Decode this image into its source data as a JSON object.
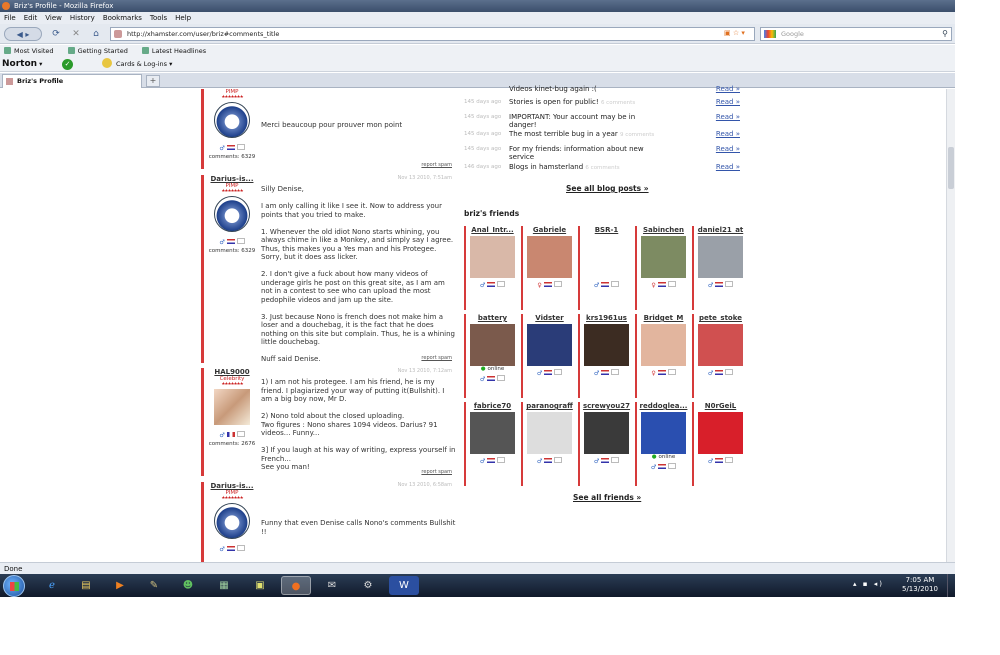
{
  "window": {
    "title": "Briz's Profile - Mozilla Firefox"
  },
  "menu": [
    "File",
    "Edit",
    "View",
    "History",
    "Bookmarks",
    "Tools",
    "Help"
  ],
  "url": "http://xhamster.com/user/briz#comments_title",
  "search_placeholder": "Google",
  "bookmarks": [
    "Most Visited",
    "Getting Started",
    "Latest Headlines"
  ],
  "norton": {
    "brand": "Norton",
    "cards_label": "Cards & Log-ins"
  },
  "tab": {
    "title": "Briz's Profile",
    "new_tab": "+"
  },
  "status": "Done",
  "comments": [
    {
      "user": "",
      "rank": "PIMP",
      "stars": "★★★★★★★",
      "count": "comments: 6329",
      "date": "",
      "text": "Merci beaucoup pour prouver mon point",
      "report": "report spam"
    },
    {
      "user": "Darius-is...",
      "rank": "PIMP",
      "stars": "★★★★★★★",
      "count": "comments: 6329",
      "date": "Nov 13 2010, 7:51am",
      "text": "Silly Denise,\n\nI am only calling it like I see it. Now to address your points that you tried to make.\n\n1. Whenever the old idiot Nono starts whining, you always chime in like a Monkey, and simply say I agree. Thus, this makes you a Yes man and his Protegee. Sorry, but it does ass licker.\n\n2. I don't give a fuck about how many videos of underage girls he post on this great site, as I am am not in a contest to see who can upload the most pedophile videos and jam up the site.\n\n3. Just because Nono is french does not make him a loser and a douchebag, it is the fact that he does nothing on this site but complain. Thus, he is a whining little douchebag.\n\nNuff said Denise.",
      "report": "report spam"
    },
    {
      "user": "HAL9000",
      "rank": "Celebrity",
      "stars": "★★★★★★★",
      "count": "comments: 2676",
      "date": "Nov 13 2010, 7:12am",
      "text": "1) I am not his protegee. I am his friend, he is my friend. I plagiarized your way of putting it(Bullshit). I am a big boy now, Mr D.\n\n2) Nono told about the closed uploading.\nTwo figures : Nono shares 1094 videos. Darius? 91 videos... Funny...\n\n3] If you laugh at his way of writing, express yourself in French...\nSee you man!",
      "report": "report spam"
    },
    {
      "user": "Darius-is...",
      "rank": "PIMP",
      "stars": "★★★★★★★",
      "count": "",
      "date": "Nov 13 2010, 6:58am",
      "text": "Funny that even Denise calls Nono's comments Bullshit !!",
      "report": ""
    }
  ],
  "blog": {
    "posts": [
      {
        "date": "",
        "title": "Videos kinet-bug again :(",
        "read": "Read »"
      },
      {
        "date": "145 days ago",
        "title": "Stories is open for public!",
        "note": "6 comments",
        "read": "Read »"
      },
      {
        "date": "145 days ago",
        "title": "IMPORTANT: Your account may be in danger!",
        "read": "Read »"
      },
      {
        "date": "145 days ago",
        "title": "The most terrible bug in a year",
        "note": "9 comments",
        "read": "Read »"
      },
      {
        "date": "145 days ago",
        "title": "For my friends: information about new service",
        "read": "Read »"
      },
      {
        "date": "146 days ago",
        "title": "Blogs in hamsterland",
        "note": "6 comments",
        "read": "Read »"
      }
    ],
    "see_all": "See all blog posts »"
  },
  "friends": {
    "title": "briz's friends",
    "see_all": "See all friends »",
    "list": [
      {
        "name": "Anal_Intr...",
        "gender": "♂",
        "online": "",
        "color": "#d9b8a8"
      },
      {
        "name": "Gabriele",
        "gender": "♀",
        "online": "",
        "color": "#c98770"
      },
      {
        "name": "BSR-1",
        "gender": "♂",
        "online": "",
        "color": "#ffffff"
      },
      {
        "name": "Sabinchen",
        "gender": "♀",
        "online": "",
        "color": "#7d8b62"
      },
      {
        "name": "daniel21_at",
        "gender": "♂",
        "online": "",
        "color": "#9aa0a8"
      },
      {
        "name": "battery",
        "gender": "♂",
        "online": "online",
        "color": "#7b5a4c"
      },
      {
        "name": "Vidster",
        "gender": "♂",
        "online": "",
        "color": "#2a3c78"
      },
      {
        "name": "krs1961us",
        "gender": "♂",
        "online": "",
        "color": "#3c2c22"
      },
      {
        "name": "Bridget_M",
        "gender": "♀",
        "online": "",
        "color": "#e2b59e"
      },
      {
        "name": "pete_stoke",
        "gender": "♂",
        "online": "",
        "color": "#d05050"
      },
      {
        "name": "fabrice70",
        "gender": "♂",
        "online": "",
        "color": "#555555"
      },
      {
        "name": "paranograff",
        "gender": "♂",
        "online": "",
        "color": "#dddddd"
      },
      {
        "name": "screwyou27",
        "gender": "♂",
        "online": "",
        "color": "#3a3a3a"
      },
      {
        "name": "reddoglea...",
        "gender": "♂",
        "online": "online",
        "color": "#2a4fb0"
      },
      {
        "name": "N0rGeiL",
        "gender": "♂",
        "online": "",
        "color": "#d81f2a"
      }
    ]
  },
  "taskbar": {
    "time": "7:05 AM",
    "date": "5/13/2010"
  },
  "colors": {
    "accent_red": "#d63a3a",
    "link_blue": "#3355aa"
  }
}
